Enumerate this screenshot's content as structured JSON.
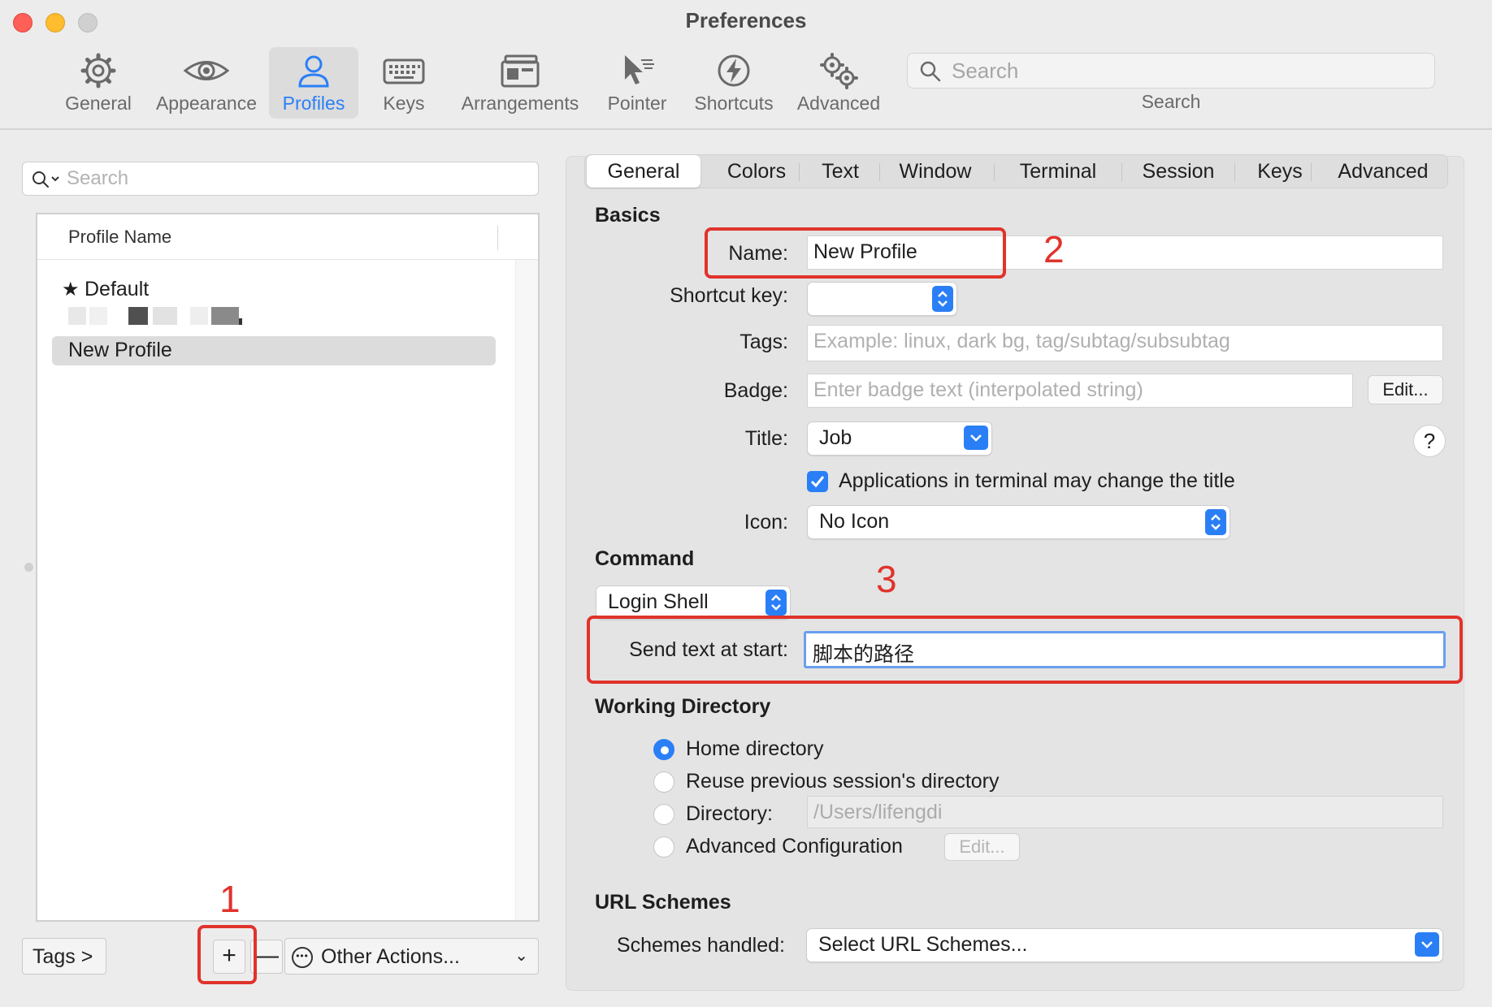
{
  "window": {
    "title": "Preferences"
  },
  "toolbar": {
    "items": [
      {
        "label": "General",
        "icon": "gear-icon"
      },
      {
        "label": "Appearance",
        "icon": "eye-icon"
      },
      {
        "label": "Profiles",
        "icon": "person-icon",
        "active": true
      },
      {
        "label": "Keys",
        "icon": "keyboard-icon"
      },
      {
        "label": "Arrangements",
        "icon": "window-stack-icon"
      },
      {
        "label": "Pointer",
        "icon": "cursor-icon"
      },
      {
        "label": "Shortcuts",
        "icon": "bolt-icon"
      },
      {
        "label": "Advanced",
        "icon": "gears-icon"
      }
    ],
    "search_placeholder": "Search",
    "search_label": "Search"
  },
  "profiles": {
    "search_placeholder": "Search",
    "column_header": "Profile Name",
    "rows": [
      {
        "name": "Default",
        "default": true
      },
      {
        "name": "New Profile",
        "selected": true
      }
    ],
    "tags_button": "Tags >",
    "add_button": "+",
    "remove_button": "—",
    "other_actions": "Other Actions..."
  },
  "tabs": [
    "General",
    "Colors",
    "Text",
    "Window",
    "Terminal",
    "Session",
    "Keys",
    "Advanced"
  ],
  "basics": {
    "section": "Basics",
    "name_label": "Name:",
    "name_value": "New Profile",
    "shortcut_label": "Shortcut key:",
    "tags_label": "Tags:",
    "tags_placeholder": "Example: linux, dark bg, tag/subtag/subsubtag",
    "badge_label": "Badge:",
    "badge_placeholder": "Enter badge text (interpolated string)",
    "badge_edit": "Edit...",
    "title_label": "Title:",
    "title_value": "Job",
    "help": "?",
    "apps_change_title": "Applications in terminal may change the title",
    "icon_label": "Icon:",
    "icon_value": "No Icon"
  },
  "command": {
    "section": "Command",
    "shell_value": "Login Shell",
    "send_text_label": "Send text at start:",
    "send_text_value": "脚本的路径"
  },
  "working_directory": {
    "section": "Working Directory",
    "options": [
      "Home directory",
      "Reuse previous session's directory",
      "Directory:",
      "Advanced Configuration"
    ],
    "selected_index": 0,
    "directory_value": "/Users/lifengdi",
    "advanced_edit": "Edit..."
  },
  "url_schemes": {
    "section": "URL Schemes",
    "label": "Schemes handled:",
    "value": "Select URL Schemes..."
  },
  "annotations": [
    "1",
    "2",
    "3"
  ],
  "colors": {
    "accent": "#2a7ff6",
    "annotation": "#e0332b"
  }
}
